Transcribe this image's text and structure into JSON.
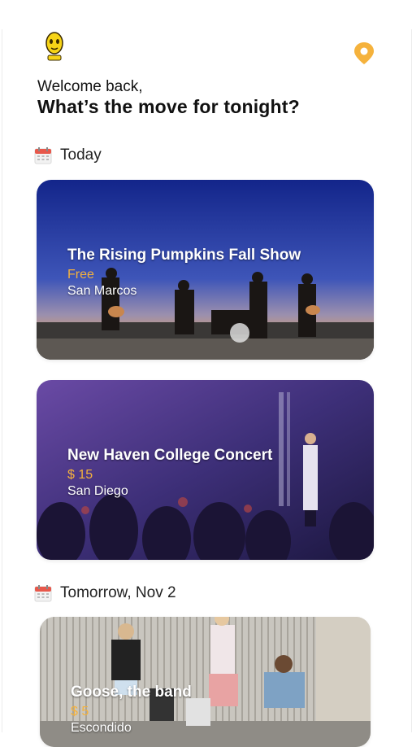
{
  "header": {
    "logo_icon": "yellow-face-logo",
    "location_icon": "map-pin-icon",
    "accent_color": "#f5b23c"
  },
  "greeting": {
    "welcome": "Welcome back,",
    "headline": "What’s the move for tonight?"
  },
  "sections": [
    {
      "label": "Today",
      "icon": "calendar-icon",
      "events": [
        {
          "title": "The Rising Pumpkins Fall Show",
          "price": "Free",
          "city": "San Marcos"
        },
        {
          "title": "New Haven College Concert",
          "price": "$ 15",
          "city": "San Diego"
        }
      ]
    },
    {
      "label": "Tomorrow, Nov 2",
      "icon": "calendar-icon",
      "events": [
        {
          "title": "Goose, the band",
          "price": "$ 5",
          "city": "Escondido"
        }
      ]
    }
  ]
}
